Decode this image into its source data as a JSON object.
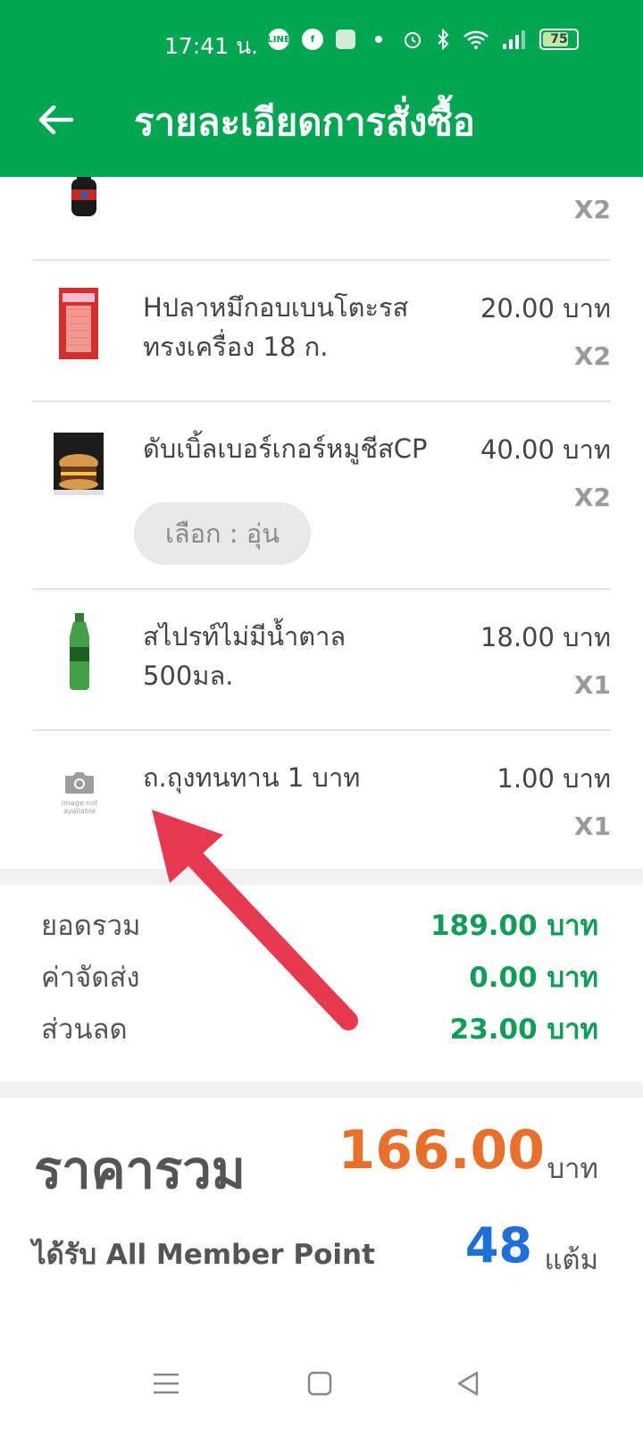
{
  "status_bar": {
    "time": "17:41 น.",
    "battery": "75",
    "icons": [
      "line-icon",
      "facebook-icon",
      "app-icon",
      "dot-icon",
      "alarm-icon",
      "bluetooth-icon",
      "wifi-icon",
      "signal-icon",
      "battery-icon"
    ]
  },
  "header": {
    "title": "รายละเอียดการสั่งซื้อ",
    "back_icon": "back-arrow-icon"
  },
  "items": [
    {
      "name": "",
      "price": "",
      "qty": "X2",
      "thumb": "pepsi-bottle"
    },
    {
      "name": "Hปลาหมึกอบเบนโตะรส ทรงเครื่อง 18 ก.",
      "price": "20.00 บาท",
      "qty": "X2",
      "thumb": "squid-snack"
    },
    {
      "name": "ดับเบิ้ลเบอร์เกอร์หมูชีสCP",
      "price": "40.00 บาท",
      "qty": "X2",
      "thumb": "burger-pack",
      "option": "เลือก : อุ่น"
    },
    {
      "name": "สไปรท์ไม่มีน้ำตาล 500มล.",
      "price": "18.00 บาท",
      "qty": "X1",
      "thumb": "sprite-bottle"
    },
    {
      "name": "ถ.ถุงทนทาน 1 บาท",
      "price": "1.00 บาท",
      "qty": "X1",
      "thumb": "image-not-available",
      "thumb_text": "image not available"
    }
  ],
  "summary": {
    "subtotal_label": "ยอดรวม",
    "subtotal_value": "189.00 บาท",
    "delivery_label": "ค่าจัดส่ง",
    "delivery_value": "0.00 บาท",
    "discount_label": "ส่วนลด",
    "discount_value": "23.00 บาท"
  },
  "total": {
    "label": "ราคารวม",
    "value": "166.00",
    "unit": "บาท"
  },
  "points": {
    "label": "ได้รับ All Member Point",
    "value": "48",
    "unit": "แต้ม"
  },
  "colors": {
    "header_green": "#00a651",
    "value_green": "#0f9d58",
    "total_orange": "#e8702a",
    "points_blue": "#1e6fd9",
    "arrow_red": "#e63950"
  },
  "nav": {
    "icons": [
      "menu-icon",
      "home-square-icon",
      "back-triangle-icon"
    ]
  }
}
